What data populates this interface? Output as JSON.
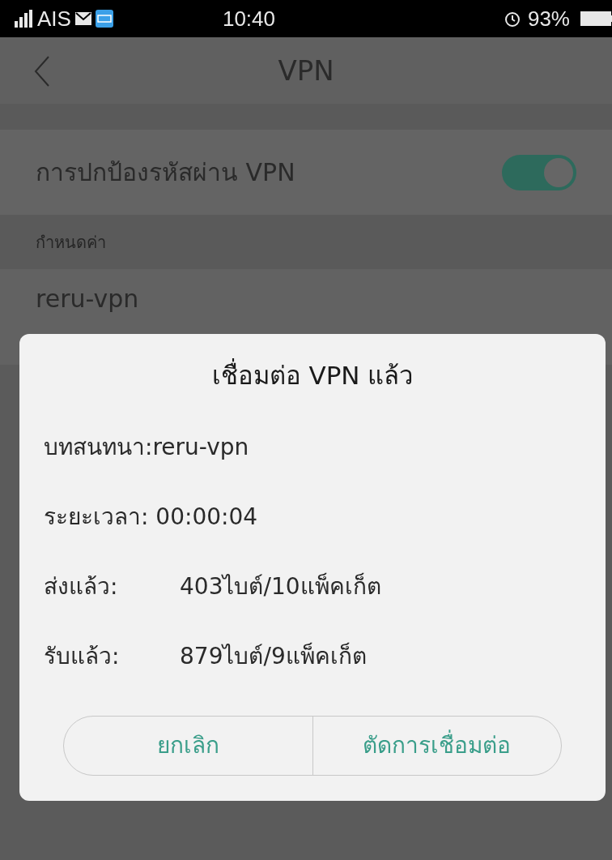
{
  "status_bar": {
    "carrier": "AIS",
    "time": "10:40",
    "battery": "93%"
  },
  "header": {
    "title": "VPN"
  },
  "vpn_protection": {
    "label": "การปกป้องรหัสผ่าน VPN",
    "on": true
  },
  "section": {
    "title": "กำหนดค่า"
  },
  "profiles": [
    {
      "name": "reru-vpn"
    }
  ],
  "dialog": {
    "title": "เชื่อมต่อ VPN แล้ว",
    "rows": [
      {
        "kind": "joined",
        "label": "บทสนทนา:reru-vpn"
      },
      {
        "kind": "joined",
        "label": "ระยะเวลา: 00:00:04"
      },
      {
        "kind": "split",
        "label": "ส่งแล้ว:",
        "value": "403ไบต์/10แพ็คเก็ต"
      },
      {
        "kind": "split",
        "label": "รับแล้ว:",
        "value": "879ไบต์/9แพ็คเก็ต"
      }
    ],
    "buttons": [
      "ยกเลิก",
      "ตัดการเชื่อมต่อ"
    ]
  }
}
